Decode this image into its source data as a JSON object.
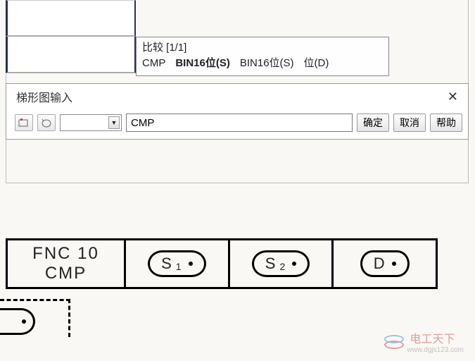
{
  "tooltip": {
    "title": "比较 [1/1]",
    "cmd": "CMP",
    "arg1": "BIN16位(S)",
    "arg2": "BIN16位(S)",
    "arg3": "位(D)"
  },
  "dialog": {
    "title": "梯形图输入",
    "input_value": "CMP ",
    "ok": "确定",
    "cancel": "取消",
    "help": "帮助"
  },
  "instruction": {
    "fnc": "FNC 10",
    "name": "CMP",
    "op1": "S",
    "op1_sub": "1",
    "op2": "S",
    "op2_sub": "2",
    "op3": "D"
  },
  "watermark": {
    "text": "电工天下",
    "url": "www.dgjs123.com"
  }
}
